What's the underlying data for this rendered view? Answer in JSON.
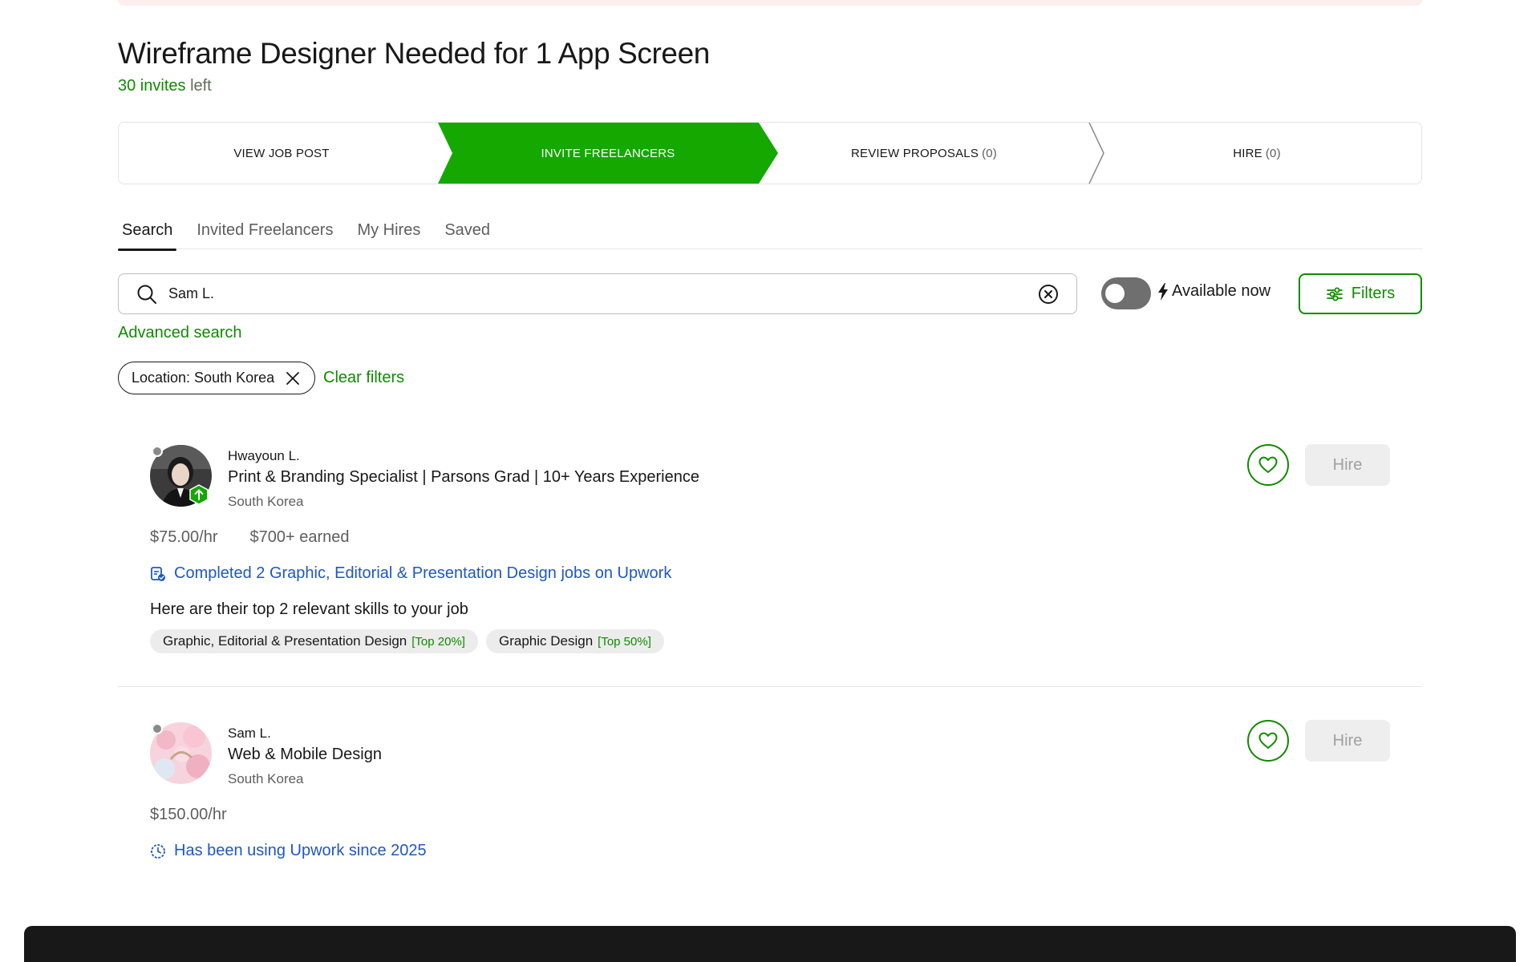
{
  "job": {
    "title": "Wireframe Designer Needed for 1 App Screen",
    "invites_count": "30 invites",
    "invites_suffix": "left"
  },
  "stepper": {
    "steps": [
      {
        "label": "VIEW JOB POST",
        "count": ""
      },
      {
        "label": "INVITE FREELANCERS",
        "count": ""
      },
      {
        "label": "REVIEW PROPOSALS",
        "count": "(0)"
      },
      {
        "label": "HIRE",
        "count": "(0)"
      }
    ],
    "active_color": "#14a800"
  },
  "tabs": [
    {
      "label": "Search"
    },
    {
      "label": "Invited Freelancers"
    },
    {
      "label": "My Hires"
    },
    {
      "label": "Saved"
    }
  ],
  "search": {
    "value": "Sam L.",
    "available_label": "Available now",
    "filters_label": "Filters",
    "advanced_label": "Advanced search"
  },
  "filters": {
    "chip_label": "Location: South Korea",
    "clear_label": "Clear filters"
  },
  "freelancers": [
    {
      "name": "Hwayoun L.",
      "title": "Print & Branding Specialist | Parsons Grad | 10+ Years Experience",
      "location": "South Korea",
      "rate": "$75.00/hr",
      "earned": "$700+ earned",
      "info": "Completed 2 Graphic, Editorial & Presentation Design jobs on Upwork",
      "skills_heading": "Here are their top 2 relevant skills to your job",
      "skills": [
        {
          "name": "Graphic, Editorial & Presentation Design",
          "rank": "[Top 20%]"
        },
        {
          "name": "Graphic Design",
          "rank": "[Top 50%]"
        }
      ],
      "hire_label": "Hire"
    },
    {
      "name": "Sam L.",
      "title": "Web & Mobile Design",
      "location": "South Korea",
      "rate": "$150.00/hr",
      "info": "Has been using Upwork since 2025",
      "hire_label": "Hire"
    }
  ],
  "colors": {
    "brand_green": "#108a00",
    "link_blue": "#1f57c3"
  }
}
